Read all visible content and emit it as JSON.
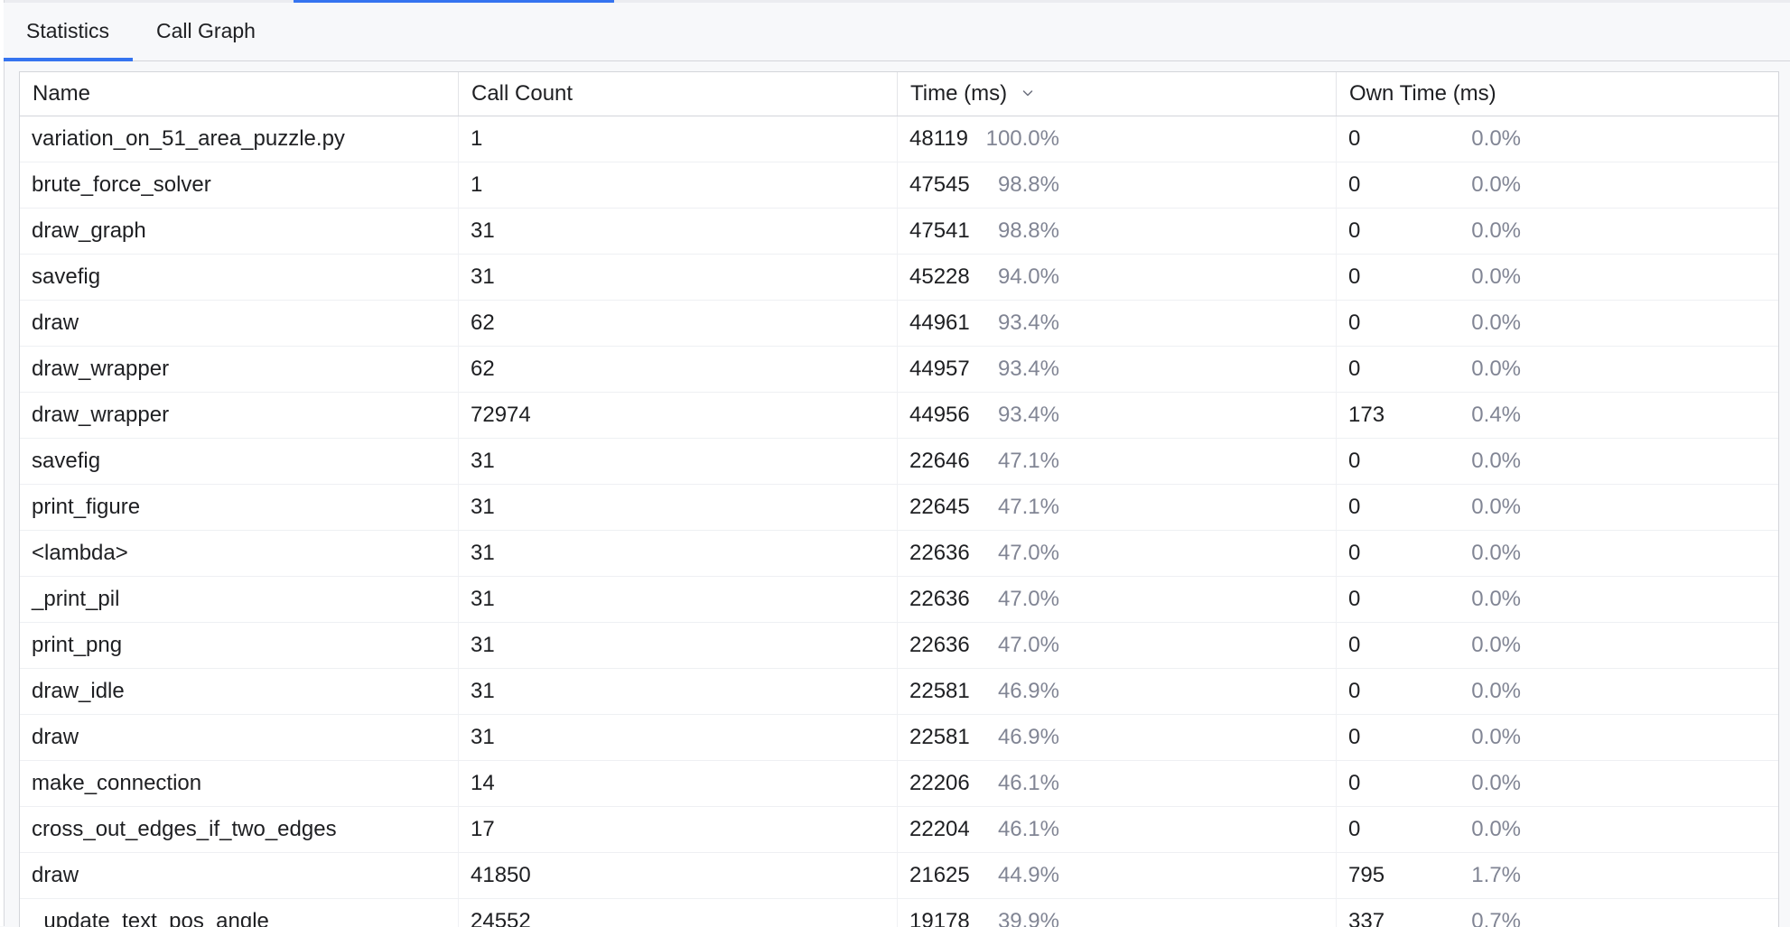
{
  "tabs": [
    {
      "label": "Statistics",
      "active": true
    },
    {
      "label": "Call Graph",
      "active": false
    }
  ],
  "columns": {
    "name": "Name",
    "call_count": "Call Count",
    "time": "Time (ms)",
    "own_time": "Own Time (ms)"
  },
  "sort": {
    "column": "time",
    "direction": "descending",
    "icon": "chevron-down-icon"
  },
  "colors": {
    "accent": "#3574f0",
    "muted_text": "#818594"
  },
  "rows": [
    {
      "name": "variation_on_51_area_puzzle.py",
      "count": "1",
      "time": "48119",
      "time_pct": "100.0%",
      "own": "0",
      "own_pct": "0.0%"
    },
    {
      "name": "brute_force_solver",
      "count": "1",
      "time": "47545",
      "time_pct": "98.8%",
      "own": "0",
      "own_pct": "0.0%"
    },
    {
      "name": "draw_graph",
      "count": "31",
      "time": "47541",
      "time_pct": "98.8%",
      "own": "0",
      "own_pct": "0.0%"
    },
    {
      "name": "savefig",
      "count": "31",
      "time": "45228",
      "time_pct": "94.0%",
      "own": "0",
      "own_pct": "0.0%"
    },
    {
      "name": "draw",
      "count": "62",
      "time": "44961",
      "time_pct": "93.4%",
      "own": "0",
      "own_pct": "0.0%"
    },
    {
      "name": "draw_wrapper",
      "count": "62",
      "time": "44957",
      "time_pct": "93.4%",
      "own": "0",
      "own_pct": "0.0%"
    },
    {
      "name": "draw_wrapper",
      "count": "72974",
      "time": "44956",
      "time_pct": "93.4%",
      "own": "173",
      "own_pct": "0.4%"
    },
    {
      "name": "savefig",
      "count": "31",
      "time": "22646",
      "time_pct": "47.1%",
      "own": "0",
      "own_pct": "0.0%"
    },
    {
      "name": "print_figure",
      "count": "31",
      "time": "22645",
      "time_pct": "47.1%",
      "own": "0",
      "own_pct": "0.0%"
    },
    {
      "name": "<lambda>",
      "count": "31",
      "time": "22636",
      "time_pct": "47.0%",
      "own": "0",
      "own_pct": "0.0%"
    },
    {
      "name": "_print_pil",
      "count": "31",
      "time": "22636",
      "time_pct": "47.0%",
      "own": "0",
      "own_pct": "0.0%"
    },
    {
      "name": "print_png",
      "count": "31",
      "time": "22636",
      "time_pct": "47.0%",
      "own": "0",
      "own_pct": "0.0%"
    },
    {
      "name": "draw_idle",
      "count": "31",
      "time": "22581",
      "time_pct": "46.9%",
      "own": "0",
      "own_pct": "0.0%"
    },
    {
      "name": "draw",
      "count": "31",
      "time": "22581",
      "time_pct": "46.9%",
      "own": "0",
      "own_pct": "0.0%"
    },
    {
      "name": "make_connection",
      "count": "14",
      "time": "22206",
      "time_pct": "46.1%",
      "own": "0",
      "own_pct": "0.0%"
    },
    {
      "name": "cross_out_edges_if_two_edges",
      "count": "17",
      "time": "22204",
      "time_pct": "46.1%",
      "own": "0",
      "own_pct": "0.0%"
    },
    {
      "name": "draw",
      "count": "41850",
      "time": "21625",
      "time_pct": "44.9%",
      "own": "795",
      "own_pct": "1.7%"
    },
    {
      "name": "_update_text_pos_angle",
      "count": "24552",
      "time": "19178",
      "time_pct": "39.9%",
      "own": "337",
      "own_pct": "0.7%"
    }
  ]
}
